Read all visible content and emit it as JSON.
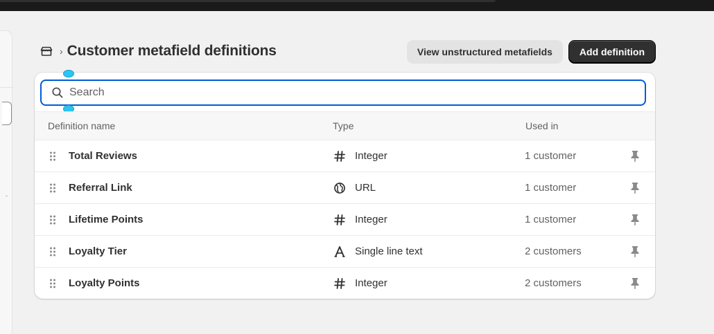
{
  "header": {
    "title": "Customer metafield definitions",
    "breadcrumb_separator": "›",
    "home_icon": "store-icon",
    "view_unstructured_label": "View unstructured metafields",
    "add_definition_label": "Add definition"
  },
  "search": {
    "placeholder": "Search",
    "value": ""
  },
  "table": {
    "columns": {
      "name": "Definition name",
      "type": "Type",
      "used_in": "Used in"
    },
    "rows": [
      {
        "name": "Total Reviews",
        "type": "Integer",
        "type_icon": "hash-icon",
        "used_in": "1 customer"
      },
      {
        "name": "Referral Link",
        "type": "URL",
        "type_icon": "globe-link-icon",
        "used_in": "1 customer"
      },
      {
        "name": "Lifetime Points",
        "type": "Integer",
        "type_icon": "hash-icon",
        "used_in": "1 customer"
      },
      {
        "name": "Loyalty Tier",
        "type": "Single line text",
        "type_icon": "text-icon",
        "used_in": "2 customers"
      },
      {
        "name": "Loyalty Points",
        "type": "Integer",
        "type_icon": "hash-icon",
        "used_in": "2 customers"
      }
    ]
  },
  "colors": {
    "page_bg": "#f1f1f1",
    "primary_button": "#303030",
    "focus_ring": "#005bd3",
    "selection_handle": "#2ec4f0"
  }
}
